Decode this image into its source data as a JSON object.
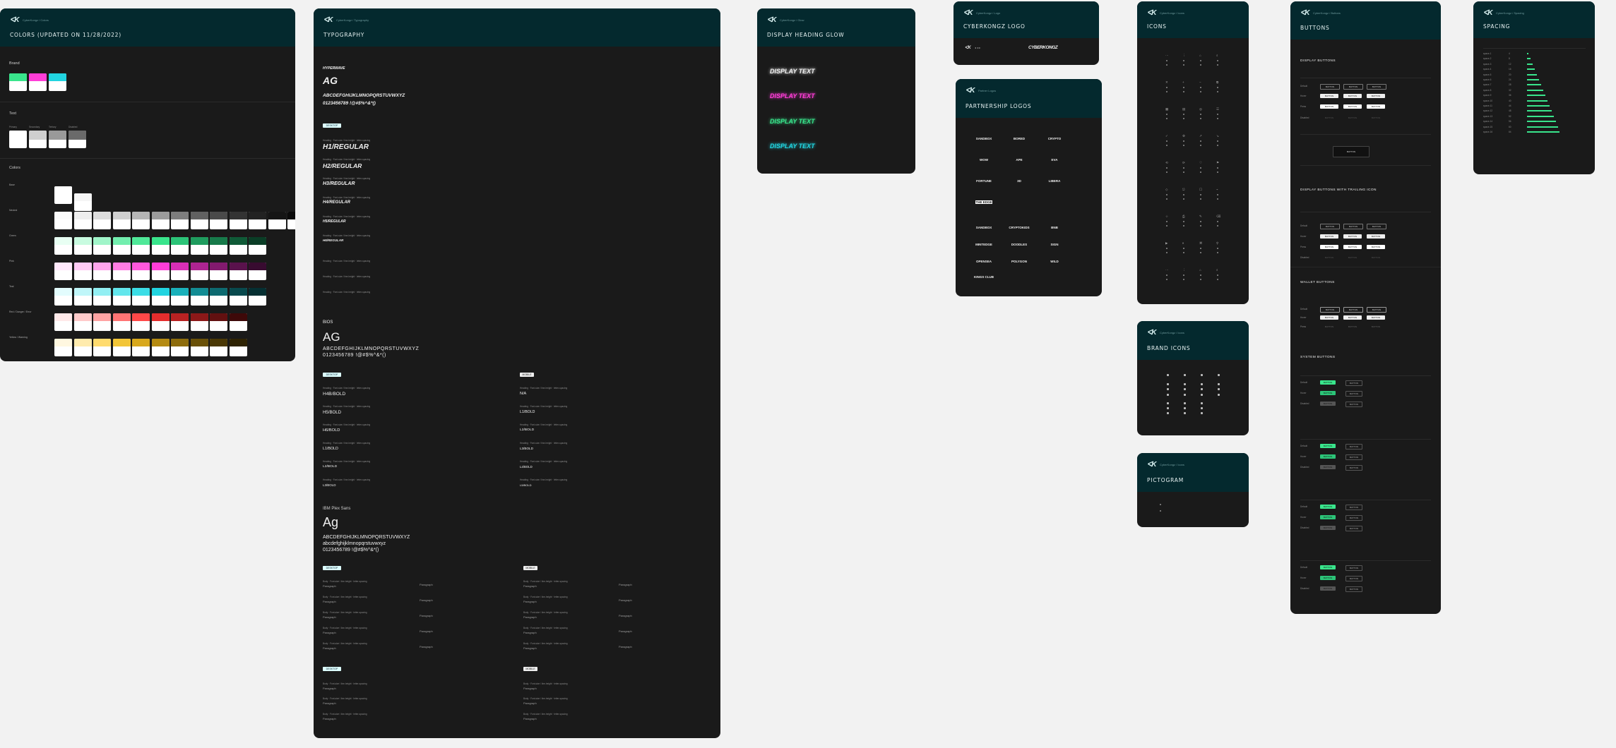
{
  "common": {
    "logo": "ᐸK",
    "logo_alt": "CYBERKONGZ"
  },
  "frames": {
    "colors": {
      "sub": "CyberKongz / Colors",
      "title": "COLORS (UPDATED ON 11/28/2022)",
      "brand_label": "Brand",
      "text_label": "Text",
      "colors_label": "Colors",
      "text_names": [
        "Primary",
        "Secondary",
        "Tertiary",
        "Disabled"
      ],
      "ramp_names": [
        "Base",
        "Neutral",
        "Green",
        "Pink",
        "Teal",
        "Red / Danger / Error",
        "Yellow / Warning"
      ]
    },
    "typography": {
      "sub": "CyberKongz / Typography",
      "title": "TYPOGRAPHY",
      "font1_name": "HYPERWAVE",
      "font1_ag": "AG",
      "font1_alpha": "ABCDEFGHIJKLMNOPQRSTUVWXYZ",
      "font1_num": "0123456789 !@#$%^&*()",
      "font2_name": "BIOS",
      "font2_ag": "AG",
      "font2_alpha": "ABCDEFGHIJKLMNOPQRSTUVWXYZ",
      "font2_num": "0123456789 !@#$%^&*()",
      "font3_name": "IBM Plex Sans",
      "font3_ag": "Ag",
      "font3_alpha": "ABCDEFGHIJKLMNOPQRSTUVWXYZ",
      "font3_lower": "abcdefghijklmnopqrstuvwxyz",
      "font3_num": "0123456789 !@#$%^&*()",
      "tag_desktop": "DESKTOP",
      "tag_mobile": "MOBILE",
      "h_styles": [
        "H1/REGULAR",
        "H2/REGULAR",
        "H3/REGULAR",
        "H4/REGULAR",
        "H5/REGULAR",
        "H6/REGULAR"
      ],
      "bios_styles": [
        "H4B/BOLD",
        "H5/BOLD",
        "H6/BOLD",
        "L1/BOLD",
        "L2/BOLD",
        "L3/BOLD"
      ],
      "bios_mobile": [
        "N/A",
        "L1/BOLD",
        "L2/BOLD",
        "L3/BOLD",
        "L4/BOLD",
        "L5/BOLD"
      ]
    },
    "glow": {
      "sub": "CyberKongz / Glow",
      "title": "DISPLAY HEADING GLOW",
      "sample": "DISPLAY TEXT"
    },
    "cklogo": {
      "sub": "CyberKongz / Logo",
      "title": "CYBERKONGZ LOGO"
    },
    "partners": {
      "sub": "Partner Logos",
      "title": "PARTNERSHIP LOGOS",
      "logos": [
        "SANDBOX",
        "BORED",
        "CRYPTO",
        "WOW",
        "APE",
        "EVA",
        "FORTUNE",
        "3D",
        "LIBERA",
        "THE EDGE",
        "SANDBOX",
        "CRYPTOKIDS",
        "BNB",
        "MINTEDGE",
        "DOODLES",
        "SIGN",
        "OPENSEA",
        "POLYGON",
        "WILD",
        "KINGS CLUB",
        "ANONYMOUS",
        "RAINBOW"
      ]
    },
    "icons": {
      "sub": "CyberKongz / Icons",
      "title": "ICONS"
    },
    "brand_icons": {
      "sub": "CyberKongz / Icons",
      "title": "BRAND ICONS"
    },
    "pictogram": {
      "sub": "CyberKongz / Icons",
      "title": "PICTOGRAM"
    },
    "buttons": {
      "sub": "CyberKongz / Buttons",
      "title": "BUTTONS",
      "sec1": "DISPLAY BUTTONS",
      "sec2": "DISPLAY BUTTONS WITH TRAILING ICON",
      "sec3": "WALLET BUTTONS",
      "sec4": "SYSTEM BUTTONS",
      "states": [
        "Default",
        "Hover",
        "Press",
        "Disabled"
      ],
      "btn_label": "BUTTON"
    },
    "spacing": {
      "sub": "CyberKongz / Spacing",
      "title": "SPACING"
    }
  }
}
